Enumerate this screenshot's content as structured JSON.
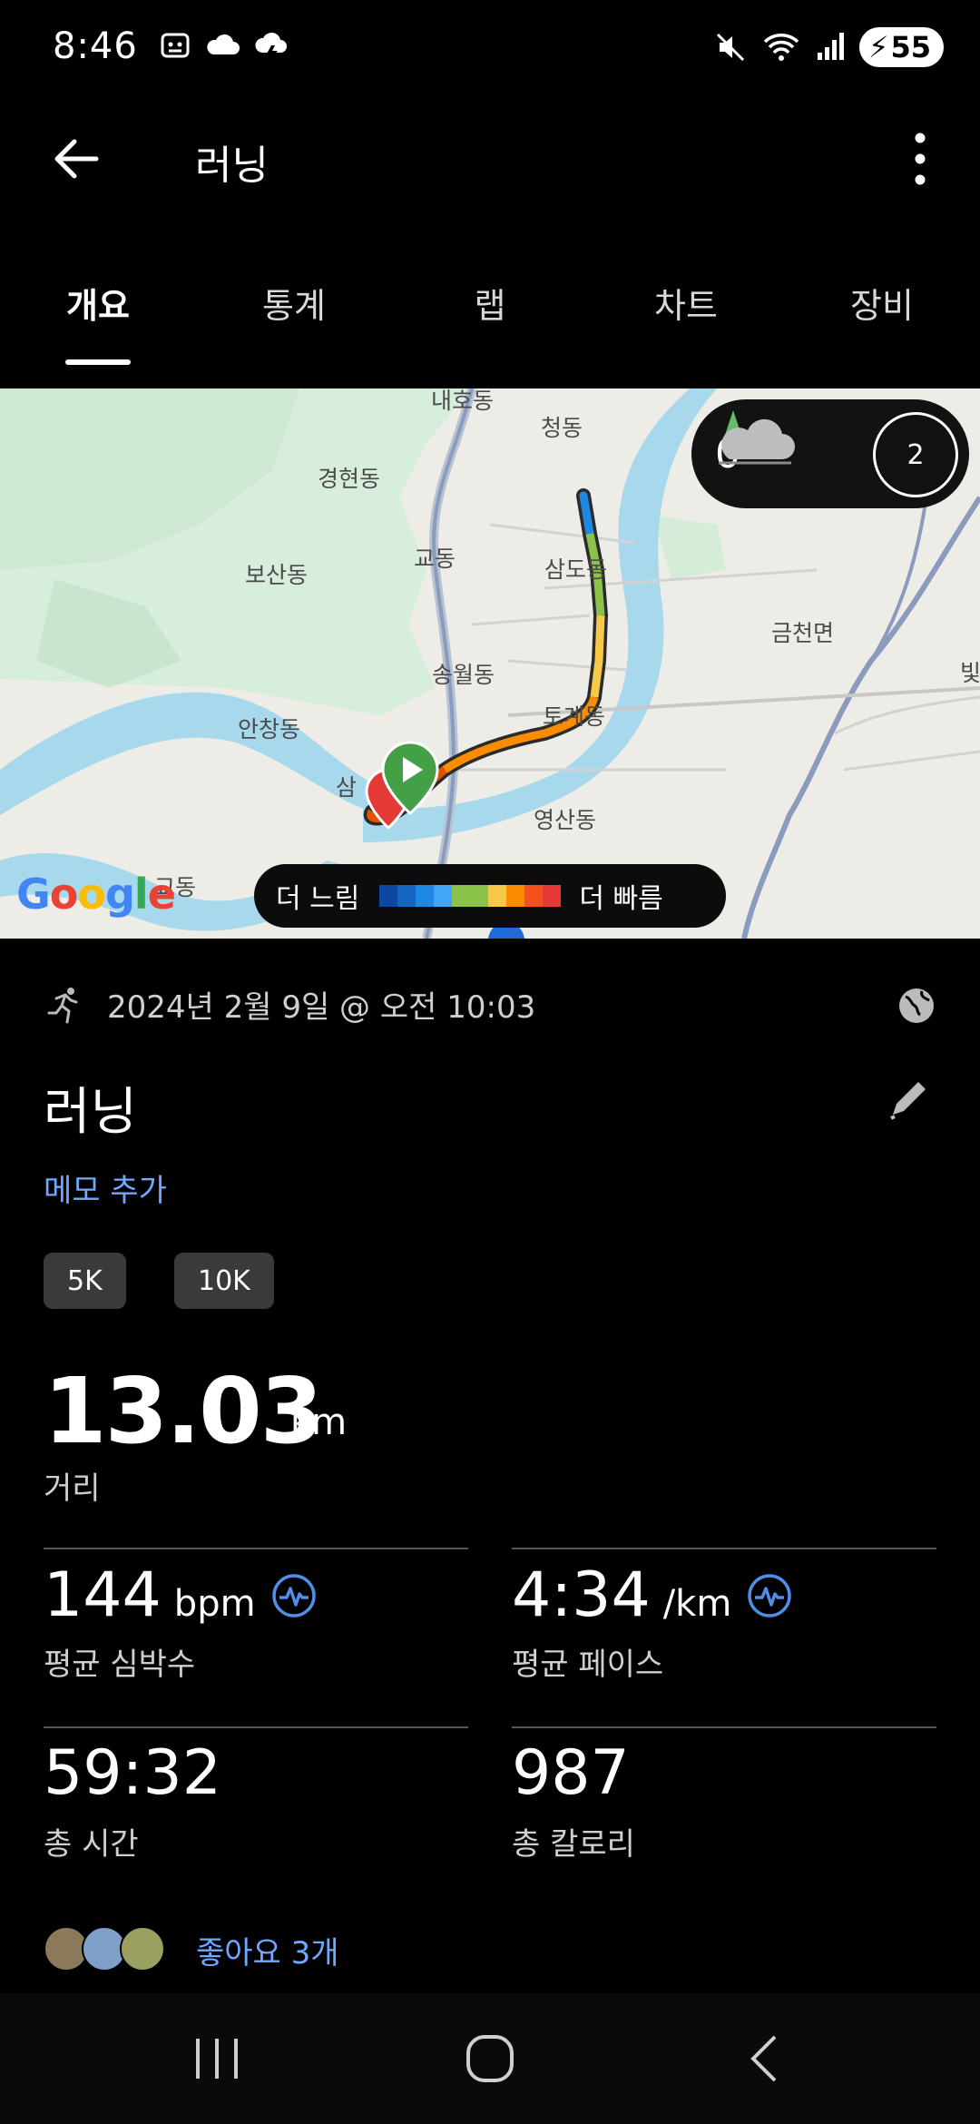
{
  "status_bar": {
    "time": "8:46",
    "battery": "55"
  },
  "app_bar": {
    "title": "러닝"
  },
  "tabs": [
    {
      "label": "개요",
      "active": true
    },
    {
      "label": "통계",
      "active": false
    },
    {
      "label": "랩",
      "active": false
    },
    {
      "label": "차트",
      "active": false
    },
    {
      "label": "장비",
      "active": false
    }
  ],
  "map": {
    "labels": [
      "내호동",
      "청동",
      "경현동",
      "교동",
      "삼도동",
      "보산동",
      "금천면",
      "송월동",
      "토계동",
      "안창동",
      "삼",
      "영산동",
      "교동",
      "빛"
    ],
    "weather": {
      "temperature": "0°",
      "uv_index": "2"
    },
    "legend": {
      "slow_label": "더 느림",
      "fast_label": "더 빠름",
      "colors": [
        "#0d47a1",
        "#1565c0",
        "#1e88e5",
        "#42a5f5",
        "#8bc34a",
        "#8bc34a",
        "#f7c948",
        "#fb8c00",
        "#f4511e",
        "#e53935"
      ]
    },
    "provider": "Google"
  },
  "activity": {
    "datetime": "2024년 2월 9일 @ 오전 10:03",
    "title": "러닝",
    "memo_link": "메모 추가",
    "chips": [
      "5K",
      "10K"
    ],
    "distance": {
      "value": "13.03",
      "unit": "km",
      "label": "거리"
    },
    "stats": [
      {
        "value": "144",
        "unit": "bpm",
        "label": "평균 심박수",
        "has_icon": true
      },
      {
        "value": "4:34",
        "unit": "/km",
        "label": "평균 페이스",
        "has_icon": true
      },
      {
        "value": "59:32",
        "unit": "",
        "label": "총 시간",
        "has_icon": false
      },
      {
        "value": "987",
        "unit": "",
        "label": "총 칼로리",
        "has_icon": false
      }
    ],
    "likes": "좋아요 3개"
  }
}
